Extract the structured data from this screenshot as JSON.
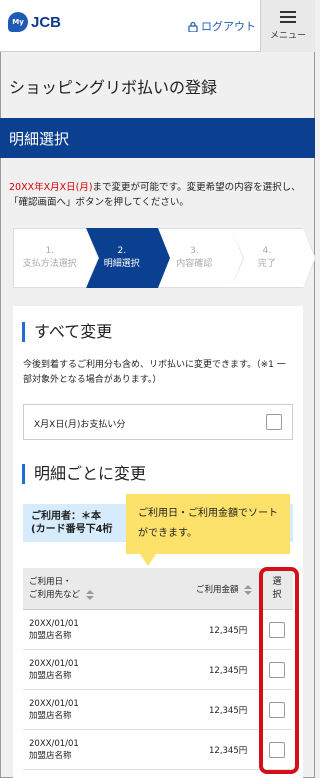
{
  "header": {
    "logo_badge": "My",
    "logo_text": "JCB",
    "logout_label": "ログアウト",
    "menu_label": "メニュー"
  },
  "page": {
    "title": "ショッピングリボ払いの登録",
    "section": "明細選択",
    "notice_red": "20XX年X月X日(月)",
    "notice_rest": "まで変更が可能です。変更希望の内容を選択し、「確認画面へ」ボタンを押してください。"
  },
  "steps": [
    {
      "num": "1.",
      "label": "支払方法選択"
    },
    {
      "num": "2.",
      "label": "明細選択"
    },
    {
      "num": "3.",
      "label": "内容確認"
    },
    {
      "num": "4.",
      "label": "完了"
    }
  ],
  "all_change": {
    "heading": "すべて変更",
    "desc": "今後到着するご利用分も含め、リボ払いに変更できます。（※1 一部対象外となる場合があります。）",
    "row_label": "X月X日(月)お支払い分"
  },
  "detail_change": {
    "heading": "明細ごとに変更",
    "holder_line1": "ご利用者：＊本",
    "holder_line2": "(カード番号下4桁",
    "tooltip": "ご利用日・ご利用金額でソートができます。"
  },
  "table": {
    "col_date_line1": "ご利用日・",
    "col_date_line2": "ご利用先など",
    "col_amount": "ご利用金額",
    "col_select": "選択",
    "rows": [
      {
        "date": "20XX/01/01",
        "merchant": "加盟店名称",
        "amount": "12,345円"
      },
      {
        "date": "20XX/01/01",
        "merchant": "加盟店名称",
        "amount": "12,345円"
      },
      {
        "date": "20XX/01/01",
        "merchant": "加盟店名称",
        "amount": "12,345円"
      },
      {
        "date": "20XX/01/01",
        "merchant": "加盟店名称",
        "amount": "12,345円"
      }
    ]
  },
  "colors": {
    "brand_navy": "#0b3f8f",
    "highlight_red": "#d50f1a",
    "tooltip_yellow": "#fce16a"
  }
}
